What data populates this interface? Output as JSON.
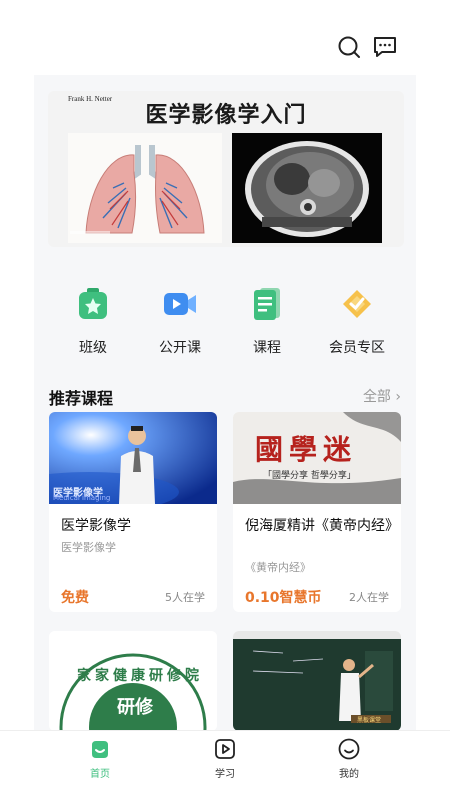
{
  "header": {
    "icons": [
      "search-icon",
      "message-icon"
    ]
  },
  "banner": {
    "credit": "Frank H. Netter",
    "title": "医学影像学入门"
  },
  "quick_menu": [
    {
      "label": "班级",
      "icon": "class-icon"
    },
    {
      "label": "公开课",
      "icon": "open-class-icon"
    },
    {
      "label": "课程",
      "icon": "course-icon"
    },
    {
      "label": "会员专区",
      "icon": "vip-icon"
    }
  ],
  "recommend": {
    "title": "推荐课程",
    "all_label": "全部 ›",
    "courses": [
      {
        "title": "医学影像学",
        "subtitle": "医学影像学",
        "thumb_text": "医学影像学",
        "thumb_subtext": "Medical imaging",
        "price": "免费",
        "learners": "5人在学"
      },
      {
        "title": "倪海厦精讲《黄帝内经》",
        "subtitle": "《黄帝内经》",
        "thumb_text": "國學迷",
        "thumb_subtext": "「國學分享 哲學分享」",
        "price": "0.10智慧币",
        "learners": "2人在学"
      },
      {
        "seal_text": "家家健康研修院",
        "seal_center": "研修"
      },
      {
        "board_label": "黑板课堂"
      }
    ]
  },
  "tabbar": [
    {
      "label": "首页",
      "icon": "home-icon",
      "active": true
    },
    {
      "label": "学习",
      "icon": "play-icon",
      "active": false
    },
    {
      "label": "我的",
      "icon": "profile-icon",
      "active": false
    }
  ],
  "colors": {
    "accent": "#3fbf7f",
    "price": "#e8762c",
    "panel_bg": "#f6f7f9"
  }
}
